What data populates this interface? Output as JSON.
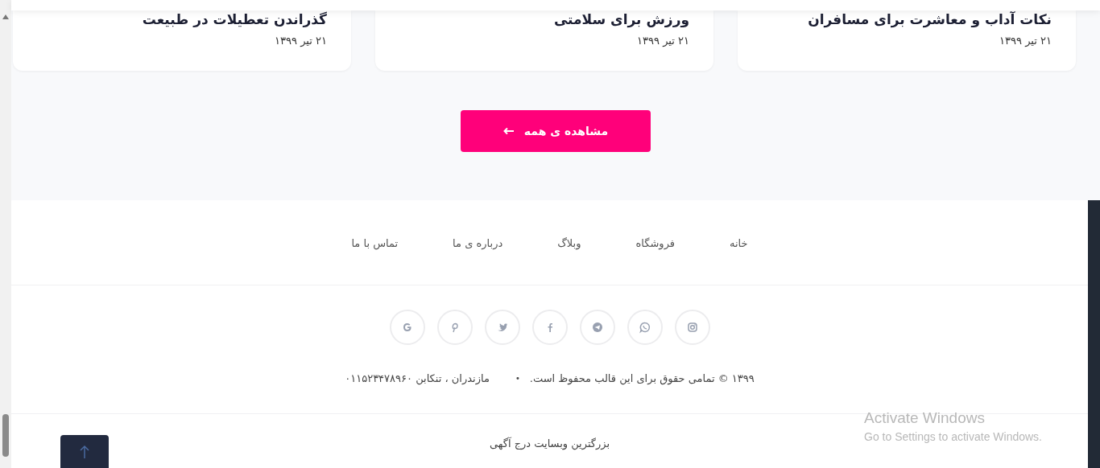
{
  "posts": [
    {
      "title": "نکات آداب و معاشرت برای مسافران",
      "date": "۲۱ تیر ۱۳۹۹"
    },
    {
      "title": "ورزش برای سلامتی",
      "date": "۲۱ تیر ۱۳۹۹"
    },
    {
      "title": "گذراندن تعطیلات در طبیعت",
      "date": "۲۱ تیر ۱۳۹۹"
    }
  ],
  "view_all_button": "مشاهده ی همه",
  "footer": {
    "nav": [
      "خانه",
      "فروشگاه",
      "وبلاگ",
      "درباره ی ما",
      "تماس با ما"
    ],
    "social": [
      {
        "kind": "instagram"
      },
      {
        "kind": "whatsapp"
      },
      {
        "kind": "telegram"
      },
      {
        "kind": "facebook"
      },
      {
        "kind": "twitter"
      },
      {
        "kind": "pinterest"
      },
      {
        "kind": "google"
      }
    ],
    "copyright": "۱۳۹۹ © تمامی حقوق برای این قالب محفوظ است.",
    "separator": "•",
    "address": "مازندران ، تنکابن ۰۱۱۵۲۳۴۷۸۹۶۰",
    "tagline": "بزرگترین وبسایت درج آگهی"
  },
  "os_notice": {
    "title": "Activate Windows",
    "text": "Go to Settings to activate Windows."
  }
}
